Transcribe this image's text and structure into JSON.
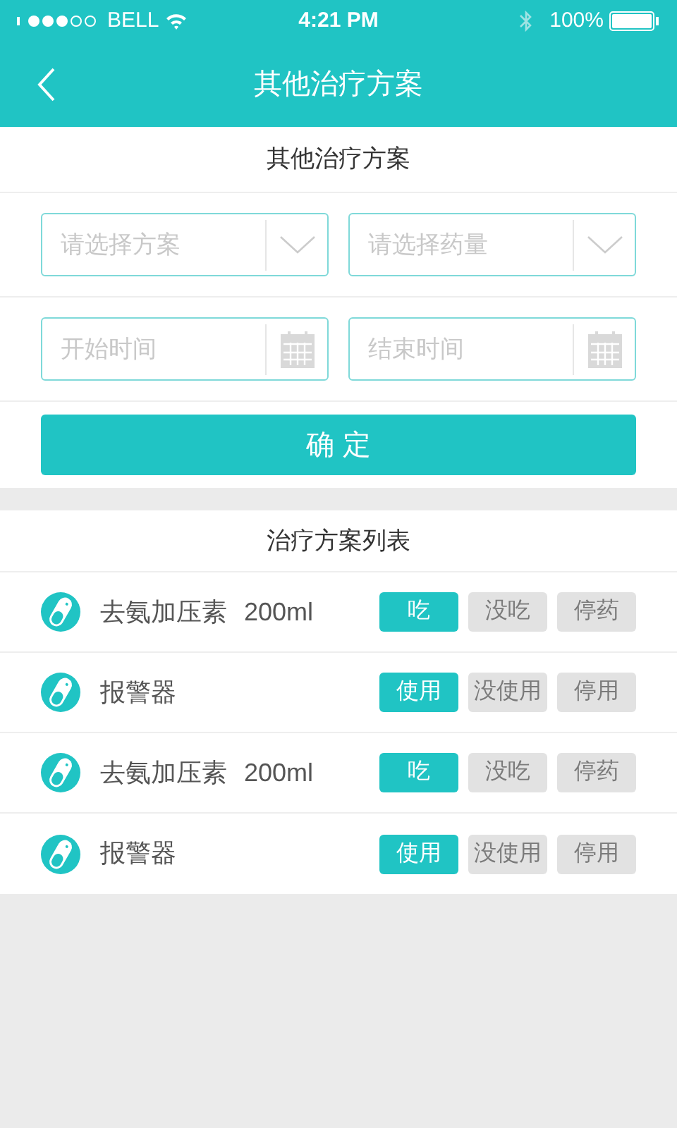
{
  "status_bar": {
    "carrier": "BELL",
    "time": "4:21 PM",
    "battery": "100%"
  },
  "nav": {
    "title": "其他治疗方案"
  },
  "form": {
    "title": "其他治疗方案",
    "fields": [
      {
        "kind": "select",
        "placeholder": "请选择方案"
      },
      {
        "kind": "select",
        "placeholder": "请选择药量"
      },
      {
        "kind": "date",
        "placeholder": "开始时间"
      },
      {
        "kind": "date",
        "placeholder": "结束时间"
      }
    ],
    "submit": "确 定"
  },
  "list": {
    "title": "治疗方案列表",
    "rows": [
      {
        "name": "去氨加压素",
        "dose": "200ml",
        "options": [
          {
            "label": "吃",
            "selected": true
          },
          {
            "label": "没吃",
            "selected": false
          },
          {
            "label": "停药",
            "selected": false
          }
        ]
      },
      {
        "name": "报警器",
        "options": [
          {
            "label": "使用",
            "selected": true
          },
          {
            "label": "没使用",
            "selected": false
          },
          {
            "label": "停用",
            "selected": false
          }
        ]
      },
      {
        "name": "去氨加压素",
        "dose": "200ml",
        "options": [
          {
            "label": "吃",
            "selected": true
          },
          {
            "label": "没吃",
            "selected": false
          },
          {
            "label": "停药",
            "selected": false
          }
        ]
      },
      {
        "name": "报警器",
        "options": [
          {
            "label": "使用",
            "selected": true
          },
          {
            "label": "没使用",
            "selected": false
          },
          {
            "label": "停用",
            "selected": false
          }
        ]
      }
    ]
  }
}
